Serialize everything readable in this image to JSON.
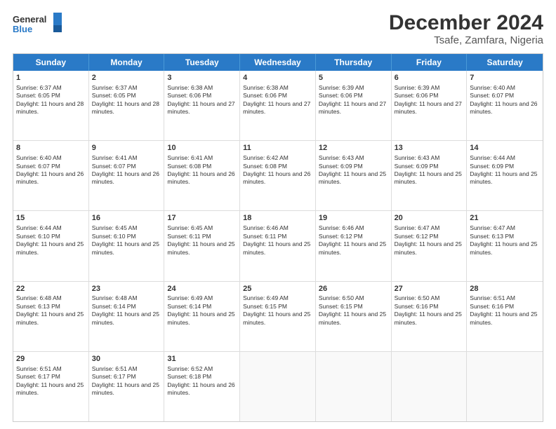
{
  "logo": {
    "line1": "General",
    "line2": "Blue"
  },
  "title": "December 2024",
  "subtitle": "Tsafe, Zamfara, Nigeria",
  "days": [
    "Sunday",
    "Monday",
    "Tuesday",
    "Wednesday",
    "Thursday",
    "Friday",
    "Saturday"
  ],
  "weeks": [
    [
      {
        "day": 1,
        "sunrise": "6:37 AM",
        "sunset": "6:05 PM",
        "daylight": "11 hours and 28 minutes."
      },
      {
        "day": 2,
        "sunrise": "6:37 AM",
        "sunset": "6:05 PM",
        "daylight": "11 hours and 28 minutes."
      },
      {
        "day": 3,
        "sunrise": "6:38 AM",
        "sunset": "6:06 PM",
        "daylight": "11 hours and 27 minutes."
      },
      {
        "day": 4,
        "sunrise": "6:38 AM",
        "sunset": "6:06 PM",
        "daylight": "11 hours and 27 minutes."
      },
      {
        "day": 5,
        "sunrise": "6:39 AM",
        "sunset": "6:06 PM",
        "daylight": "11 hours and 27 minutes."
      },
      {
        "day": 6,
        "sunrise": "6:39 AM",
        "sunset": "6:06 PM",
        "daylight": "11 hours and 27 minutes."
      },
      {
        "day": 7,
        "sunrise": "6:40 AM",
        "sunset": "6:07 PM",
        "daylight": "11 hours and 26 minutes."
      }
    ],
    [
      {
        "day": 8,
        "sunrise": "6:40 AM",
        "sunset": "6:07 PM",
        "daylight": "11 hours and 26 minutes."
      },
      {
        "day": 9,
        "sunrise": "6:41 AM",
        "sunset": "6:07 PM",
        "daylight": "11 hours and 26 minutes."
      },
      {
        "day": 10,
        "sunrise": "6:41 AM",
        "sunset": "6:08 PM",
        "daylight": "11 hours and 26 minutes."
      },
      {
        "day": 11,
        "sunrise": "6:42 AM",
        "sunset": "6:08 PM",
        "daylight": "11 hours and 26 minutes."
      },
      {
        "day": 12,
        "sunrise": "6:43 AM",
        "sunset": "6:09 PM",
        "daylight": "11 hours and 25 minutes."
      },
      {
        "day": 13,
        "sunrise": "6:43 AM",
        "sunset": "6:09 PM",
        "daylight": "11 hours and 25 minutes."
      },
      {
        "day": 14,
        "sunrise": "6:44 AM",
        "sunset": "6:09 PM",
        "daylight": "11 hours and 25 minutes."
      }
    ],
    [
      {
        "day": 15,
        "sunrise": "6:44 AM",
        "sunset": "6:10 PM",
        "daylight": "11 hours and 25 minutes."
      },
      {
        "day": 16,
        "sunrise": "6:45 AM",
        "sunset": "6:10 PM",
        "daylight": "11 hours and 25 minutes."
      },
      {
        "day": 17,
        "sunrise": "6:45 AM",
        "sunset": "6:11 PM",
        "daylight": "11 hours and 25 minutes."
      },
      {
        "day": 18,
        "sunrise": "6:46 AM",
        "sunset": "6:11 PM",
        "daylight": "11 hours and 25 minutes."
      },
      {
        "day": 19,
        "sunrise": "6:46 AM",
        "sunset": "6:12 PM",
        "daylight": "11 hours and 25 minutes."
      },
      {
        "day": 20,
        "sunrise": "6:47 AM",
        "sunset": "6:12 PM",
        "daylight": "11 hours and 25 minutes."
      },
      {
        "day": 21,
        "sunrise": "6:47 AM",
        "sunset": "6:13 PM",
        "daylight": "11 hours and 25 minutes."
      }
    ],
    [
      {
        "day": 22,
        "sunrise": "6:48 AM",
        "sunset": "6:13 PM",
        "daylight": "11 hours and 25 minutes."
      },
      {
        "day": 23,
        "sunrise": "6:48 AM",
        "sunset": "6:14 PM",
        "daylight": "11 hours and 25 minutes."
      },
      {
        "day": 24,
        "sunrise": "6:49 AM",
        "sunset": "6:14 PM",
        "daylight": "11 hours and 25 minutes."
      },
      {
        "day": 25,
        "sunrise": "6:49 AM",
        "sunset": "6:15 PM",
        "daylight": "11 hours and 25 minutes."
      },
      {
        "day": 26,
        "sunrise": "6:50 AM",
        "sunset": "6:15 PM",
        "daylight": "11 hours and 25 minutes."
      },
      {
        "day": 27,
        "sunrise": "6:50 AM",
        "sunset": "6:16 PM",
        "daylight": "11 hours and 25 minutes."
      },
      {
        "day": 28,
        "sunrise": "6:51 AM",
        "sunset": "6:16 PM",
        "daylight": "11 hours and 25 minutes."
      }
    ],
    [
      {
        "day": 29,
        "sunrise": "6:51 AM",
        "sunset": "6:17 PM",
        "daylight": "11 hours and 25 minutes."
      },
      {
        "day": 30,
        "sunrise": "6:51 AM",
        "sunset": "6:17 PM",
        "daylight": "11 hours and 25 minutes."
      },
      {
        "day": 31,
        "sunrise": "6:52 AM",
        "sunset": "6:18 PM",
        "daylight": "11 hours and 26 minutes."
      },
      null,
      null,
      null,
      null
    ]
  ],
  "labels": {
    "sunrise": "Sunrise:",
    "sunset": "Sunset:",
    "daylight": "Daylight:"
  }
}
